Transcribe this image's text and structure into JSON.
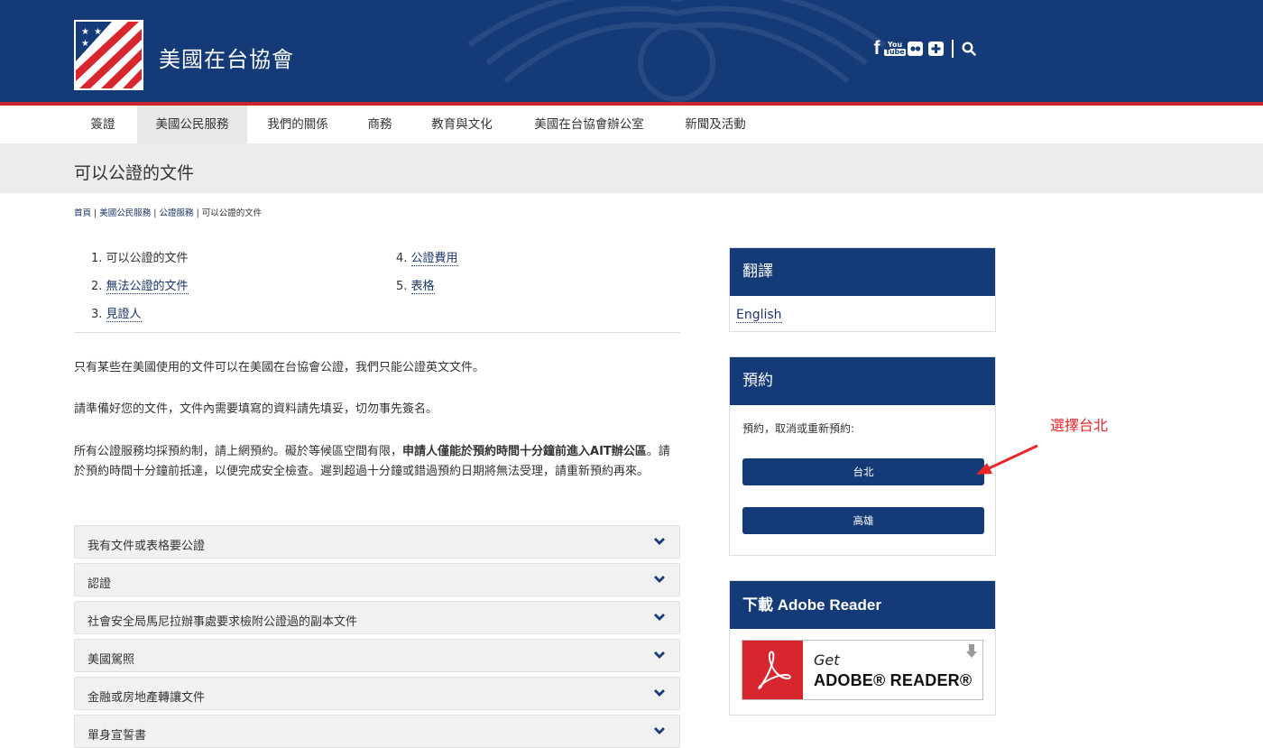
{
  "header": {
    "site_title": "美國在台協會",
    "social_icons": [
      "facebook-icon",
      "youtube-icon",
      "flickr-icon",
      "plus-icon",
      "search-icon"
    ],
    "youtube_top": "You",
    "youtube_bottom": "Tube"
  },
  "nav": {
    "items": [
      "簽證",
      "美國公民服務",
      "我們的關係",
      "商務",
      "教育與文化",
      "美國在台協會辦公室",
      "新聞及活動"
    ],
    "active": "美國公民服務"
  },
  "page": {
    "title": "可以公證的文件",
    "breadcrumb": [
      "首頁",
      "美國公民服務",
      "公證服務",
      "可以公證的文件"
    ],
    "breadcrumb_sep": " | "
  },
  "toc": [
    {
      "num": "1.",
      "label": "可以公證的文件"
    },
    {
      "num": "2.",
      "label": "無法公證的文件"
    },
    {
      "num": "3.",
      "label": "見證人"
    },
    {
      "num": "4.",
      "label": "公證費用"
    },
    {
      "num": "5.",
      "label": "表格"
    }
  ],
  "content": {
    "p1": "只有某些在美國使用的文件可以在美國在台協會公證，我們只能公證英文文件。",
    "p2": "請準備好您的文件，文件內需要填寫的資料請先填妥，切勿事先簽名。",
    "p3_a": "所有公證服務均採預約制，請上網預約。礙於等候區空間有限，",
    "p3_b": "申請人僅能於預約時間十分鐘前進入AIT辦公區",
    "p3_c": "。請於預約時間十分鐘前抵達，以便完成安全檢查。遲到超過十分鐘或錯過預約日期將無法受理，請重新預約再來。"
  },
  "accordion": [
    "我有文件或表格要公證",
    "認證",
    "社會安全局馬尼拉辦事處要求檢附公證過的副本文件",
    "美國駕照",
    "金融或房地產轉讓文件",
    "單身宣誓書"
  ],
  "sidebar": {
    "translate": {
      "title": "翻譯",
      "link": "English"
    },
    "appointment": {
      "title": "預約",
      "text": "預約，取消或重新預約:",
      "btn1": "台北",
      "btn2": "高雄"
    },
    "adobe": {
      "title": "下載 Adobe Reader",
      "get": "Get",
      "name": "ADOBE® READER®"
    }
  },
  "annotation": {
    "text": "選擇台北",
    "color": "#e8262b"
  },
  "colors": {
    "brand_blue": "#143a78",
    "accent_red": "#c8262f"
  }
}
